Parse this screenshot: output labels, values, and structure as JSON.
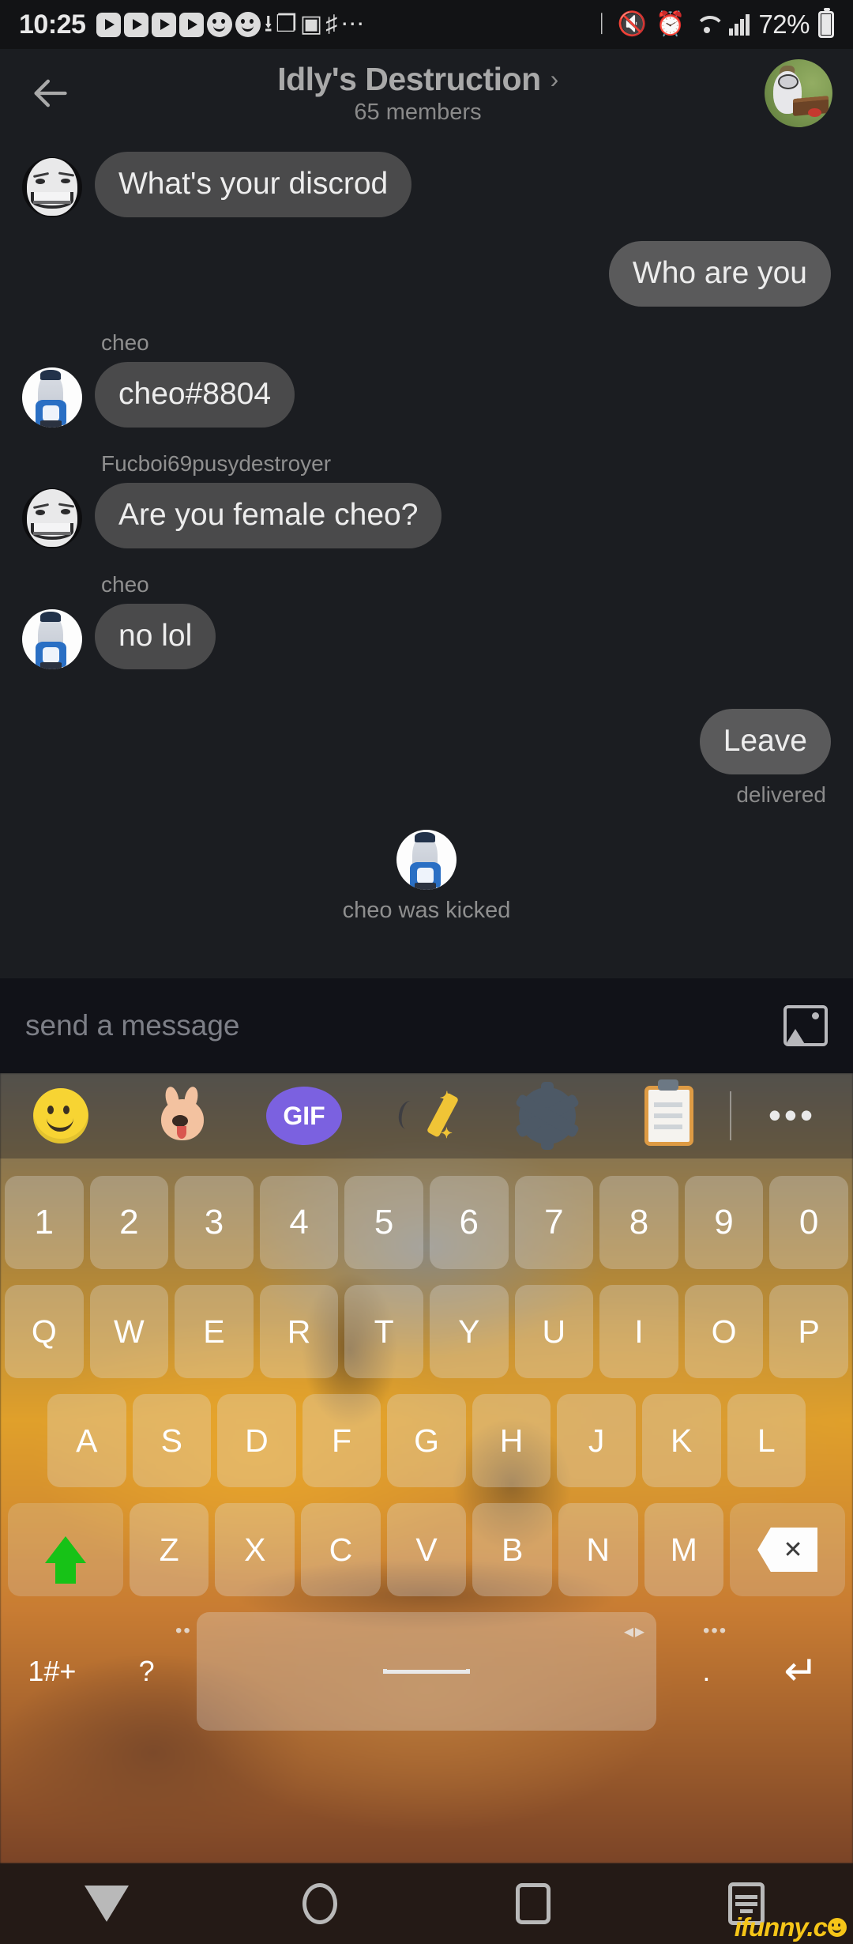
{
  "status_bar": {
    "time": "10:25",
    "battery_percent": "72%",
    "left_icons": [
      "play-icon",
      "play-icon",
      "play-icon",
      "play-icon",
      "smiley-icon",
      "smiley-icon",
      "download-icon",
      "copy-icon",
      "image-icon",
      "music-icon",
      "more-icon"
    ],
    "right_icons": [
      "bluetooth-icon",
      "mute-icon",
      "alarm-icon",
      "wifi-icon",
      "signal-icon",
      "battery-icon"
    ]
  },
  "header": {
    "back_label": "←",
    "title": "Idly's Destruction",
    "chevron": "›",
    "subtitle": "65 members",
    "avatar_name": "group-avatar"
  },
  "chat": {
    "messages": [
      {
        "type": "incoming",
        "sender": "",
        "text": "What's your discrod",
        "avatar": "troll"
      },
      {
        "type": "outgoing",
        "sender": "",
        "text": "Who are you",
        "avatar": ""
      },
      {
        "type": "incoming",
        "sender": "cheo",
        "text": "cheo#8804",
        "avatar": "cheo"
      },
      {
        "type": "incoming",
        "sender": "Fucboi69pusydestroyer",
        "text": "Are you female cheo?",
        "avatar": "troll"
      },
      {
        "type": "incoming",
        "sender": "cheo",
        "text": "no lol",
        "avatar": "cheo"
      },
      {
        "type": "outgoing",
        "sender": "",
        "text": "Leave",
        "avatar": ""
      }
    ],
    "delivered_label": "delivered",
    "system_event": "cheo was kicked"
  },
  "input_bar": {
    "placeholder": "send a message",
    "attach_icon": "image-icon"
  },
  "keyboard": {
    "toolbar": [
      {
        "name": "emoji-icon",
        "label": ""
      },
      {
        "name": "sticker-icon",
        "label": ""
      },
      {
        "name": "gif-icon",
        "label": "GIF"
      },
      {
        "name": "handwriting-icon",
        "label": ""
      },
      {
        "name": "gear-icon",
        "label": ""
      },
      {
        "name": "clipboard-icon",
        "label": ""
      },
      {
        "name": "more-icon",
        "label": "•••"
      }
    ],
    "row_numbers": [
      "1",
      "2",
      "3",
      "4",
      "5",
      "6",
      "7",
      "8",
      "9",
      "0"
    ],
    "row_top": [
      "Q",
      "W",
      "E",
      "R",
      "T",
      "Y",
      "U",
      "I",
      "O",
      "P"
    ],
    "row_mid": [
      "A",
      "S",
      "D",
      "F",
      "G",
      "H",
      "J",
      "K",
      "L"
    ],
    "row_bottom": [
      "Z",
      "X",
      "C",
      "V",
      "B",
      "N",
      "M"
    ],
    "shift_label": "",
    "backspace_label": "✕",
    "symbols_label": "1#+",
    "question_label": "?",
    "space_label": "",
    "period_label": ".",
    "enter_label": "↵",
    "hint_left": "••",
    "hint_mid": "◂▸",
    "hint_right": "•••"
  },
  "nav_bar": {
    "back": "back-icon",
    "home": "home-icon",
    "recents": "recents-icon",
    "hide_keyboard": "hide-keyboard-icon"
  },
  "watermark": {
    "text": "ifunny.c"
  }
}
